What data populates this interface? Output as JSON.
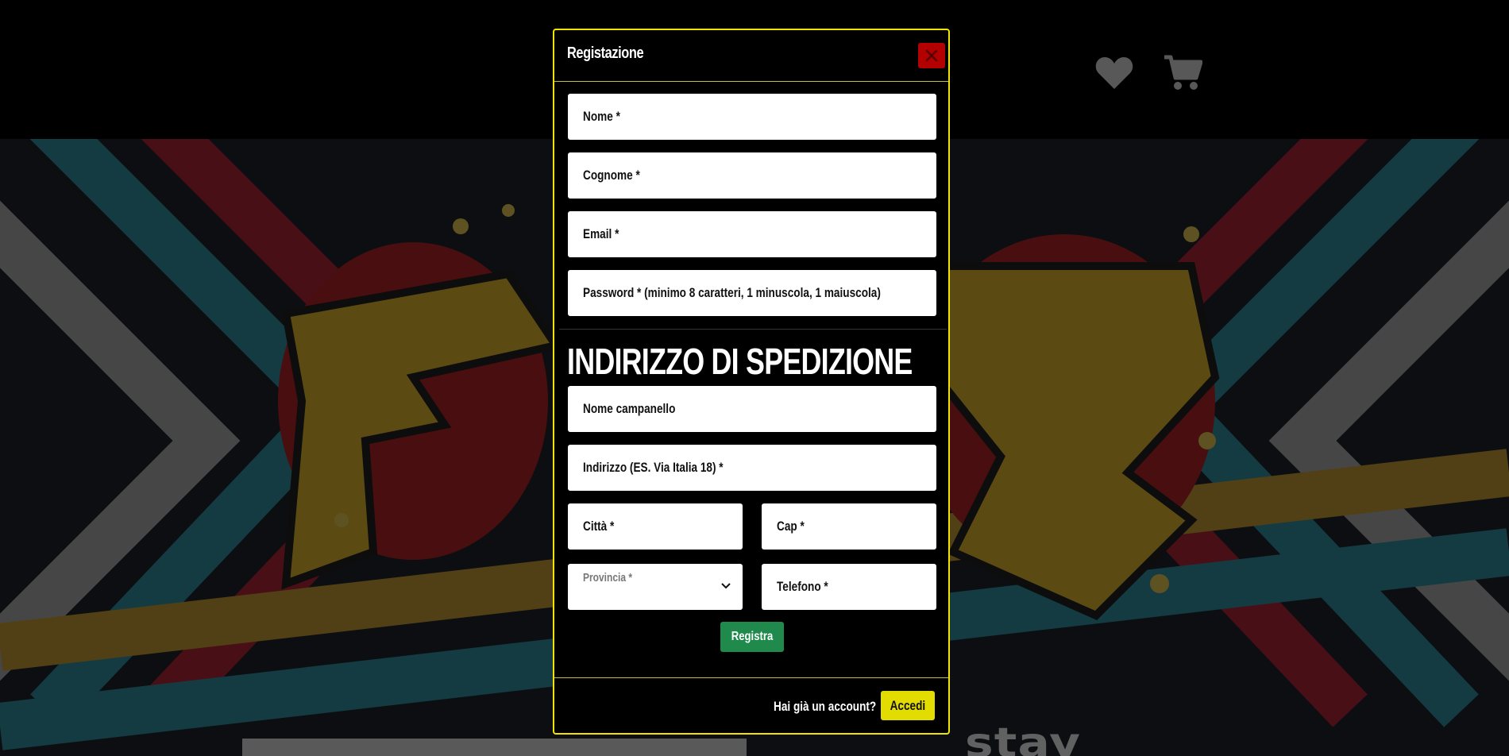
{
  "header": {
    "wishlist_icon": "heart-icon",
    "cart_icon": "cart-icon"
  },
  "background": {
    "bottom_word": "stay"
  },
  "modal": {
    "title": "Registazione",
    "close_icon": "close-icon",
    "fields": {
      "nome": "Nome *",
      "cognome": "Cognome *",
      "email": "Email *",
      "password": "Password * (minimo 8 caratteri, 1 minuscola, 1 maiuscola)"
    },
    "shipping": {
      "title": "INDIRIZZO DI SPEDIZIONE",
      "campanello": "Nome campanello",
      "indirizzo": "Indirizzo (ES. Via Italia 18) *",
      "citta": "Città *",
      "cap": "Cap *",
      "provincia": "Provincia *",
      "telefono": "Telefono *"
    },
    "submit_label": "Registra",
    "footer": {
      "account_text": "Hai già un account?",
      "login_label": "Accedi"
    }
  },
  "colors": {
    "modal_border": "#f2e400",
    "close_button": "#b30000",
    "submit_button": "#1f8a4c",
    "login_button": "#e3dc00"
  }
}
